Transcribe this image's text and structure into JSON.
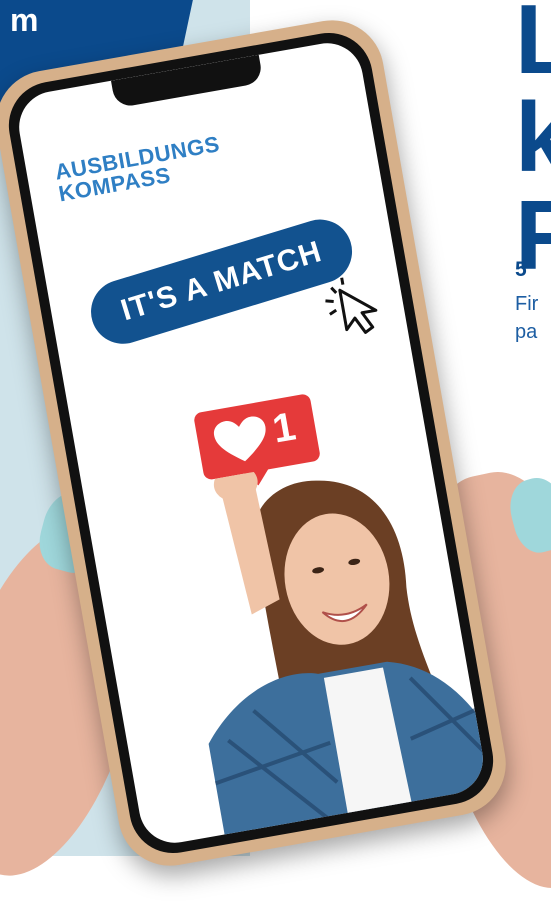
{
  "corner": {
    "text": "m"
  },
  "heading": {
    "text": "L\nk\nF"
  },
  "side": {
    "number": "5",
    "text": "Fir\npa"
  },
  "app": {
    "logo_line1": "AUSBILDUNGS",
    "logo_line2": "KOMPASS",
    "match_label": "IT'S A MATCH",
    "like_count": "1"
  },
  "colors": {
    "brand_blue": "#0b4a8c",
    "pill_blue": "#12528f",
    "logo_blue": "#2f7fc4",
    "like_red": "#e53a3a",
    "background_blue": "#cfe3ea"
  },
  "icons": [
    "cursor-icon",
    "heart-icon"
  ]
}
